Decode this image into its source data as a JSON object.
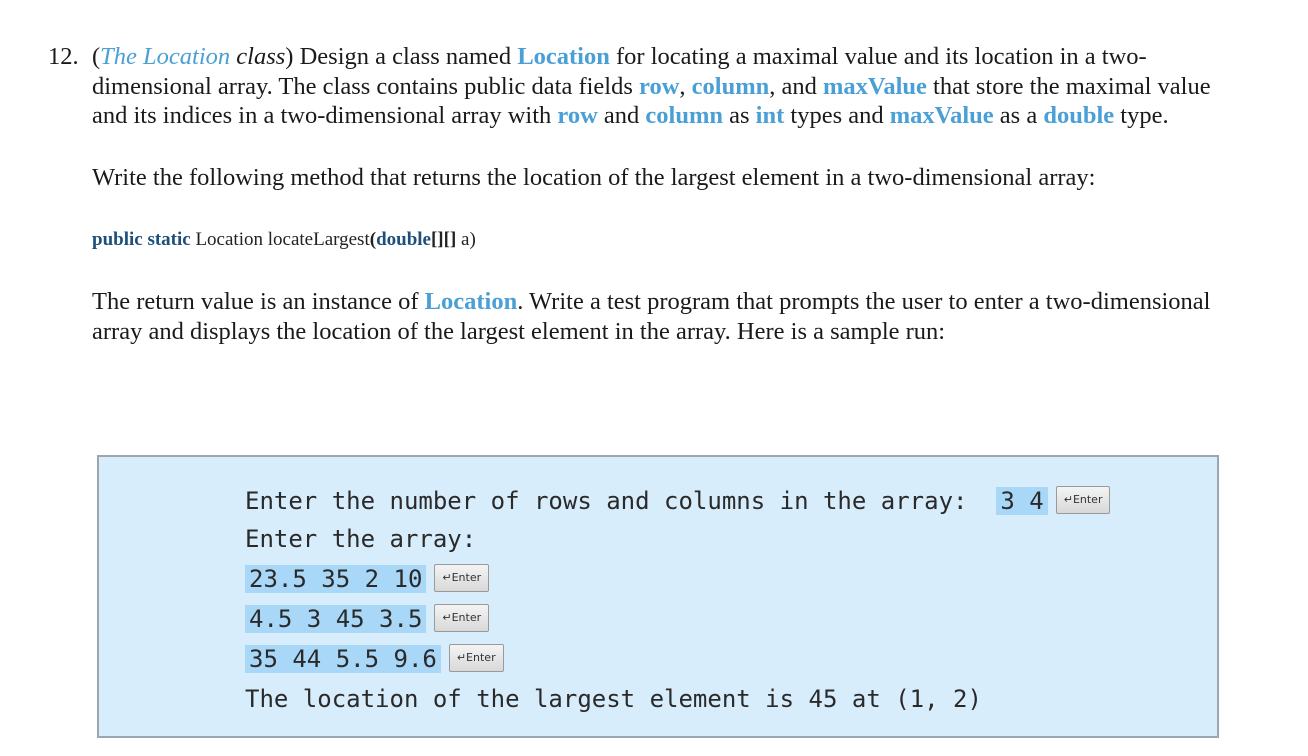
{
  "problem": {
    "number": "12.",
    "title_open": "(",
    "title_class_name": "The Location",
    "title_class_word": "class",
    "title_close": ")",
    "line1_a": " Design a class named ",
    "line1_location": "Location",
    "line1_b": " for locating a maximal value and its location in a two-",
    "line2_a": "dimensional array. The class contains public data fields ",
    "line2_row": "row",
    "line2_comma1": ", ",
    "line2_column": "column",
    "line2_and": ", and ",
    "line2_maxvalue": "maxValue",
    "line2_b": " that store the maximal value",
    "line3_a": "and its indices in a two-dimensional array with ",
    "line3_row": "row",
    "line3_and": " and ",
    "line3_column": "column",
    "line3_as": " as ",
    "line3_int": "int",
    "line3_types": " types and ",
    "line3_maxvalue": "maxValue",
    "line3_asa": " as a ",
    "line3_double": "double",
    "line3_end": " type.",
    "para2": "Write the following method that returns the location of the largest element in a two-dimensional array:",
    "signature": {
      "modifiers": "public static",
      "return_type": " Location ",
      "method": "locateLargest",
      "open": "(",
      "param_type": "double",
      "brackets": "[][]",
      "param": " a)"
    },
    "para3_a": "The return value is an instance of ",
    "para3_location": "Location",
    "para3_b": ". Write a test program that prompts the user to enter a two-dimensional",
    "para3_line2": "array and displays the location of the largest element in the array. Here is a sample run:"
  },
  "console": {
    "line1_prompt": "Enter the number of rows and columns in the array:",
    "line1_input": "3 4",
    "line2": "Enter the array:",
    "row1": "23.5 35 2 10",
    "row2": "4.5 3 45 3.5",
    "row3": "35 44 5.5 9.6",
    "result": "The location of the largest element is 45 at (1, 2)",
    "enter_label": "↵Enter"
  }
}
